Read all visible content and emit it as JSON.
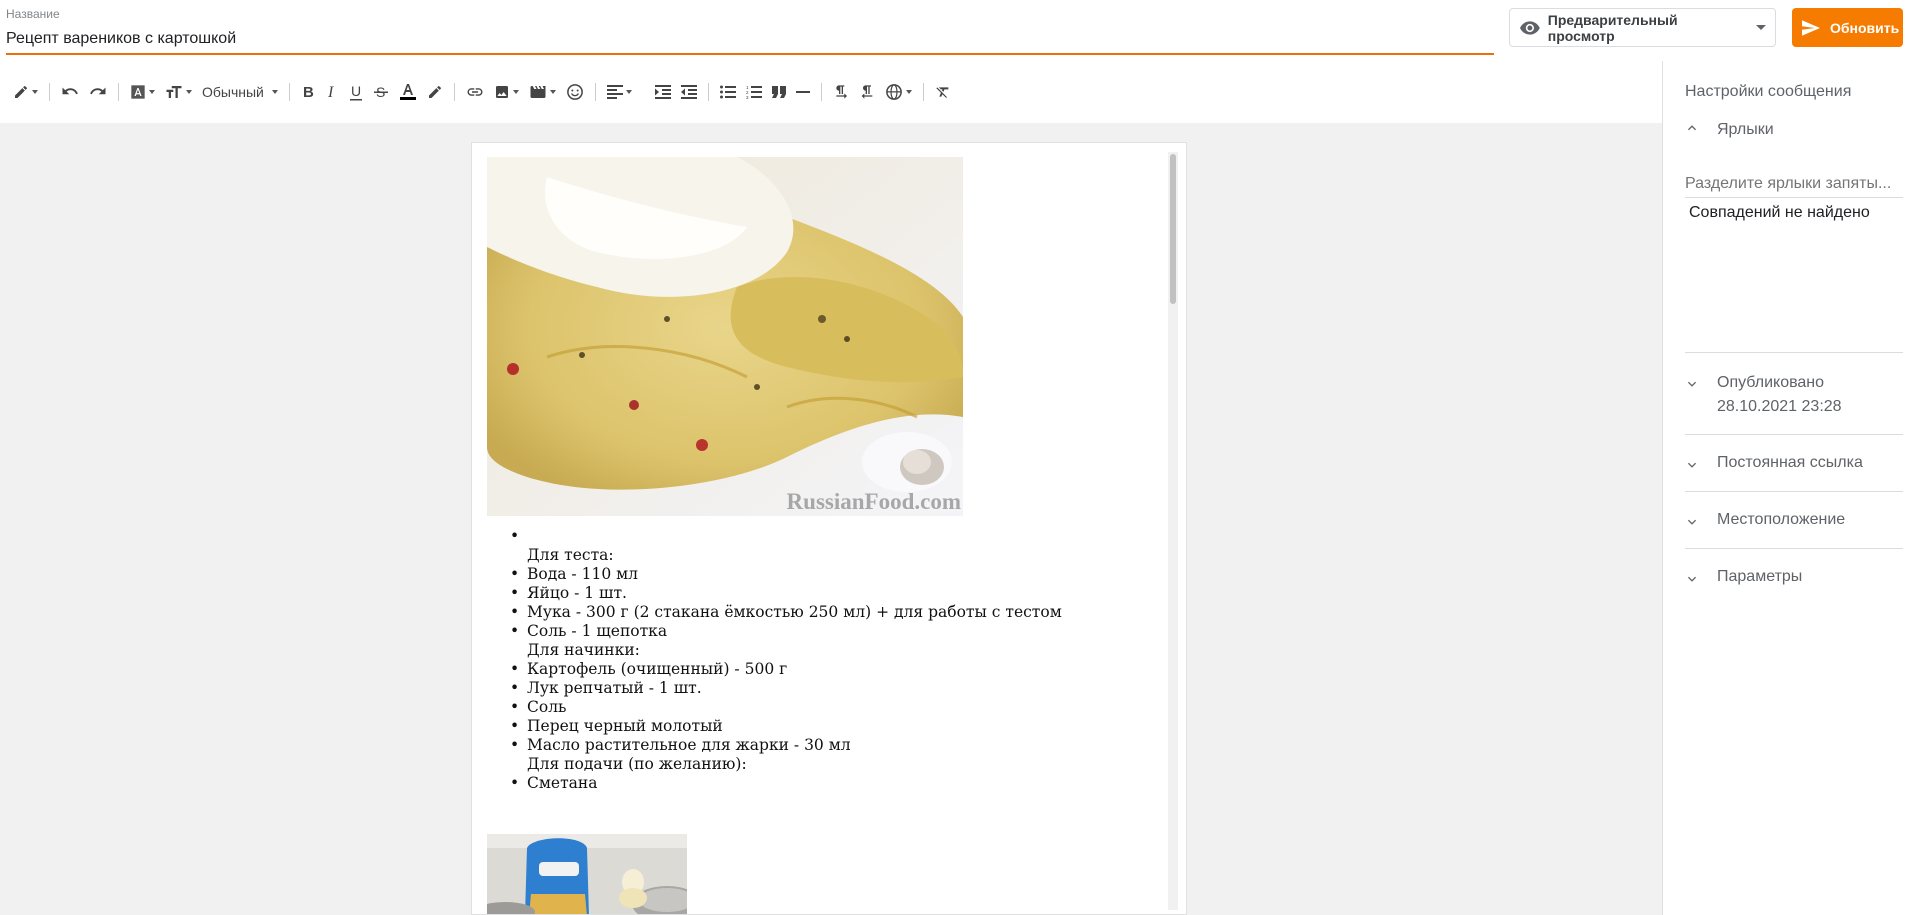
{
  "header": {
    "title_label": "Название",
    "title_value": "Рецепт вареников с картошкой",
    "preview_label": "Предварительный просмотр",
    "update_label": "Обновить"
  },
  "toolbar": {
    "format_label": "Обычный"
  },
  "document": {
    "watermark": "RussianFood.com",
    "ingredients": [
      {
        "text": "",
        "bullet": true
      },
      {
        "text": "Для теста:",
        "bullet": false
      },
      {
        "text": "Вода - 110 мл",
        "bullet": true
      },
      {
        "text": "Яйцо - 1 шт.",
        "bullet": true
      },
      {
        "text": "Мука - 300 г (2 стакана ёмкостью 250 мл) + для работы с тестом",
        "bullet": true
      },
      {
        "text": "Соль - 1 щепотка",
        "bullet": true
      },
      {
        "text": " Для начинки:",
        "bullet": false
      },
      {
        "text": "Картофель (очищенный) - 500 г",
        "bullet": true
      },
      {
        "text": "Лук репчатый - 1 шт.",
        "bullet": true
      },
      {
        "text": "Соль",
        "bullet": true
      },
      {
        "text": "Перец черный молотый",
        "bullet": true
      },
      {
        "text": "Масло растительное для жарки - 30 мл",
        "bullet": true
      },
      {
        "text": "Для подачи (по желанию):",
        "bullet": false
      },
      {
        "text": "Сметана",
        "bullet": true
      }
    ]
  },
  "sidebar": {
    "title": "Настройки сообщения",
    "labels_section": "Ярлыки",
    "labels_placeholder": "Разделите ярлыки запяты...",
    "labels_empty": "Совпадений не найдено",
    "published_label": "Опубликовано",
    "published_date": "28.10.2021 23:28",
    "permalink_label": "Постоянная ссылка",
    "location_label": "Местоположение",
    "options_label": "Параметры"
  },
  "colors": {
    "accent": "#f57c00",
    "underline": "#e8710a"
  }
}
